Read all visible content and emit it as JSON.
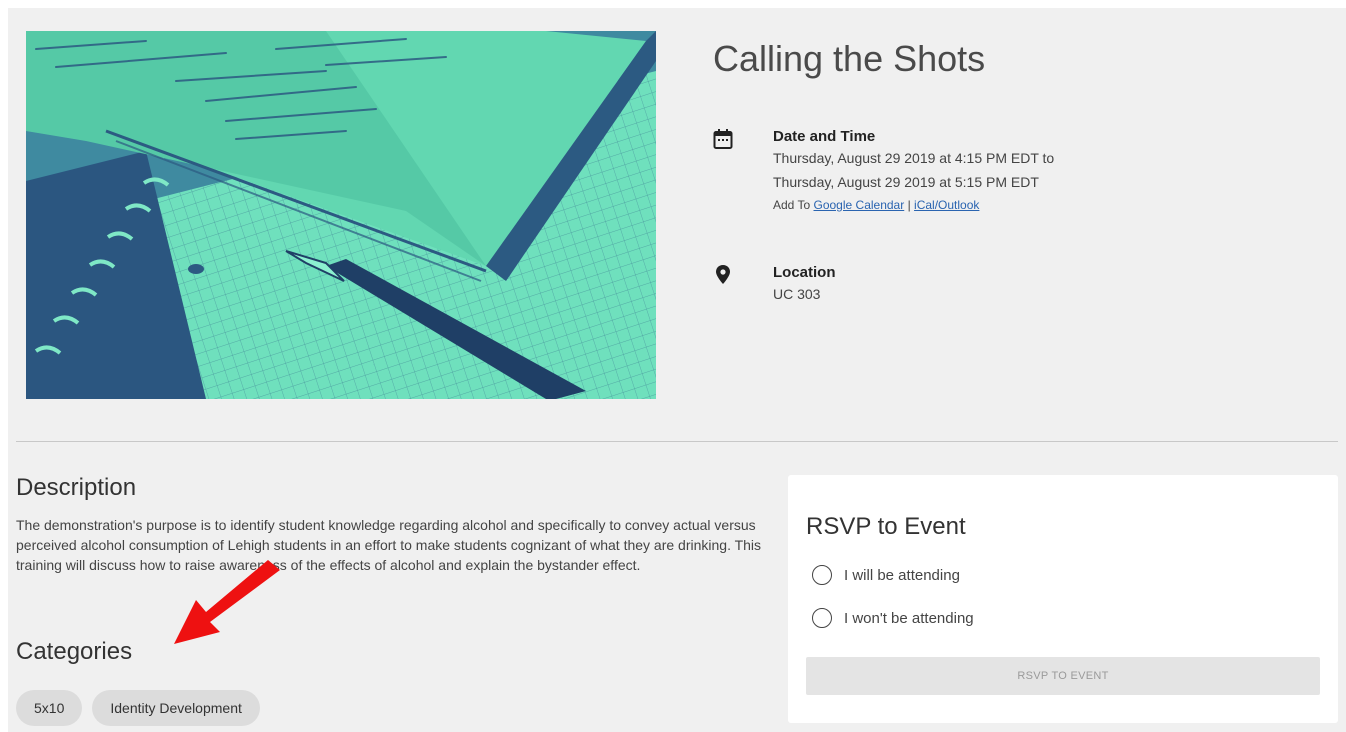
{
  "event": {
    "title": "Calling the Shots"
  },
  "datetime": {
    "heading": "Date and Time",
    "start": "Thursday, August 29 2019 at 4:15 PM EDT to",
    "end": "Thursday, August 29 2019 at 5:15 PM EDT",
    "add_to_label": "Add To",
    "google_link": "Google Calendar",
    "separator": "|",
    "ical_link": "iCal/Outlook",
    "icon": "calendar-icon"
  },
  "location": {
    "heading": "Location",
    "value": "UC 303",
    "icon": "map-pin-icon"
  },
  "description": {
    "heading": "Description",
    "text": "The demonstration's purpose is to identify student knowledge regarding alcohol and specifically to convey actual versus perceived alcohol consumption of Lehigh students in an effort to make students cognizant of what they are drinking. This training will discuss how to raise awareness of the effects of alcohol and explain the bystander effect."
  },
  "categories": {
    "heading": "Categories",
    "items": [
      "5x10",
      "Identity Development"
    ]
  },
  "rsvp": {
    "title": "RSVP to Event",
    "option_attending": "I will be attending",
    "option_not_attending": "I won't be attending",
    "button_label": "RSVP TO EVENT"
  },
  "colors": {
    "link": "#2a64b0",
    "page_background": "#f0f0f0",
    "annotation_arrow": "#ee1111",
    "image_teal": "#5fd6b0",
    "image_navy": "#2c5a82"
  }
}
